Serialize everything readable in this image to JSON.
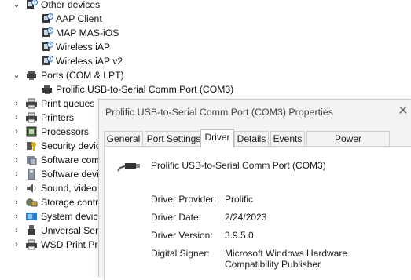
{
  "tree": {
    "other_devices": {
      "label": "Other devices",
      "children": [
        "AAP Client",
        "MAP MAS-iOS",
        "Wireless iAP",
        "Wireless iAP v2"
      ]
    },
    "ports": {
      "label": "Ports (COM & LPT)",
      "children": [
        "Prolific USB-to-Serial Comm Port (COM3)"
      ]
    },
    "categories": [
      "Print queues",
      "Printers",
      "Processors",
      "Security devic",
      "Software com",
      "Software devi",
      "Sound, video",
      "Storage contro",
      "System device",
      "Universal Seria",
      "WSD Print Pro"
    ]
  },
  "dialog": {
    "title": "Prolific USB-to-Serial Comm Port (COM3) Properties",
    "close_glyph": "✕",
    "tabs": [
      "General",
      "Port Settings",
      "Driver",
      "Details",
      "Events",
      "Power Management"
    ],
    "active_tab": "Driver",
    "device_name": "Prolific USB-to-Serial Comm Port (COM3)",
    "properties": [
      {
        "label": "Driver Provider:",
        "value": "Prolific"
      },
      {
        "label": "Driver Date:",
        "value": "2/24/2023"
      },
      {
        "label": "Driver Version:",
        "value": "3.9.5.0"
      },
      {
        "label": "Digital Signer:",
        "value": "Microsoft Windows Hardware Compatibility Publisher"
      }
    ]
  },
  "icons": {
    "expanded": "chevron-down-icon",
    "collapsed": "chevron-right-icon",
    "unknown_device": "unknown-device-icon",
    "port": "port-connector-icon",
    "usb_cable": "usb-cable-icon"
  },
  "colors": {
    "warning_badge": "#1e6fd0",
    "text": "#1a1a1a",
    "dialog_bg": "#f3f3f3"
  }
}
